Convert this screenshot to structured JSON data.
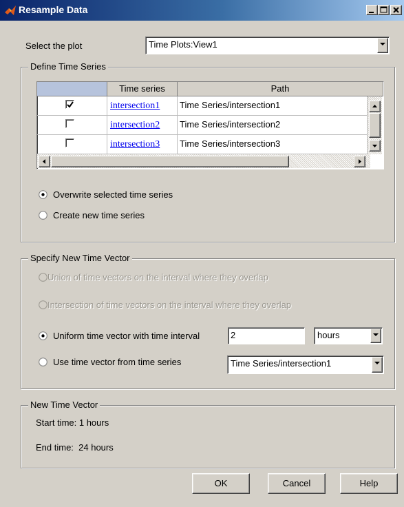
{
  "window": {
    "title": "Resample Data"
  },
  "select_plot": {
    "label": "Select the plot",
    "value": "Time Plots:View1"
  },
  "define_time_series": {
    "title": "Define Time Series",
    "columns": [
      "",
      "Time series",
      "Path"
    ],
    "rows": [
      {
        "checked": true,
        "name": "intersection1",
        "path": "Time Series/intersection1"
      },
      {
        "checked": false,
        "name": "intersection2",
        "path": "Time Series/intersection2"
      },
      {
        "checked": false,
        "name": "intersection3",
        "path": "Time Series/intersection3"
      }
    ],
    "overwrite_label": "Overwrite selected time series",
    "create_label": "Create new time series",
    "selected_option": "overwrite"
  },
  "new_time_vector_spec": {
    "title": "Specify New Time Vector",
    "union_label": "Union of time vectors on the interval where they overlap",
    "intersection_label": "Intersection of time vectors on the interval where they overlap",
    "uniform_label": "Uniform time vector with time interval",
    "uniform_interval": "2",
    "uniform_unit": "hours",
    "from_series_label": "Use time vector from time series",
    "from_series_value": "Time Series/intersection1",
    "selected_option": "uniform"
  },
  "new_time_vector": {
    "title": "New Time Vector",
    "start": "Start time: 1 hours",
    "end": "End time:  24 hours"
  },
  "buttons": {
    "ok": "OK",
    "cancel": "Cancel",
    "help": "Help"
  }
}
